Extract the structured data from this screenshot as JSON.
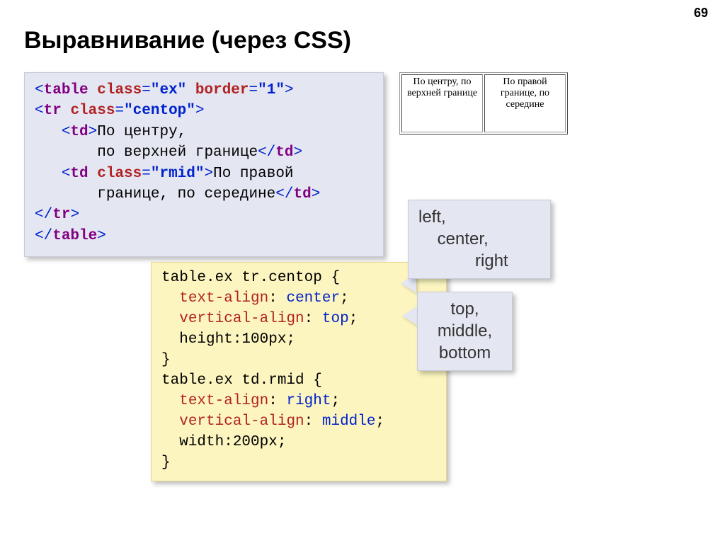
{
  "page_number": "69",
  "title": "Выравнивание (через CSS)",
  "html_code": {
    "l1_open": "<",
    "l1_tag": "table",
    "l1_attr1": "class",
    "l1_val1": "\"ex\"",
    "l1_attr2": "border",
    "l1_val2": "\"1\"",
    "l1_close": ">",
    "l2_open": "<",
    "l2_tag": "tr",
    "l2_attr": "class",
    "l2_val": "\"centop\"",
    "l2_close": ">",
    "l3_indent": "   ",
    "l3_open": "<",
    "l3_tag": "td",
    "l3_close": ">",
    "l3_text": "По центру,",
    "l4_indent": "       ",
    "l4_text": "по верхней границе",
    "l4_end_open": "</",
    "l4_end_tag": "td",
    "l4_end_close": ">",
    "l5_indent": "   ",
    "l5_open": "<",
    "l5_tag": "td",
    "l5_attr": "class",
    "l5_val": "\"rmid\"",
    "l5_close": ">",
    "l5_text": "По правой",
    "l6_indent": "       ",
    "l6_text": "границе, по середине",
    "l6_end_open": "</",
    "l6_end_tag": "td",
    "l6_end_close": ">",
    "l7_open": "</",
    "l7_tag": "tr",
    "l7_close": ">",
    "l8_open": "</",
    "l8_tag": "table",
    "l8_close": ">"
  },
  "css_code": {
    "sel1": "table.ex tr.centop {",
    "p1_name": "text-align",
    "p1_sep": ": ",
    "p1_val": "center",
    "p1_end": ";",
    "p2_name": "vertical-align",
    "p2_sep": ": ",
    "p2_val": "top",
    "p2_end": ";",
    "p3": "height:100px;",
    "close1": "}",
    "sel2": "table.ex td.rmid {",
    "p4_name": "text-align",
    "p4_sep": ": ",
    "p4_val": "right",
    "p4_end": ";",
    "p5_name": "vertical-align",
    "p5_sep": ": ",
    "p5_val": "middle",
    "p5_end": ";",
    "p6": "width:200px;",
    "close2": "}"
  },
  "callout1": {
    "l1": "left,",
    "l2": "    center,",
    "l3": "            right"
  },
  "callout2": {
    "l1": "top,",
    "l2": "middle,",
    "l3": "bottom"
  },
  "example_table": {
    "cell1": "По центру, по верхней границе",
    "cell2": "По правой границе, по середине"
  }
}
